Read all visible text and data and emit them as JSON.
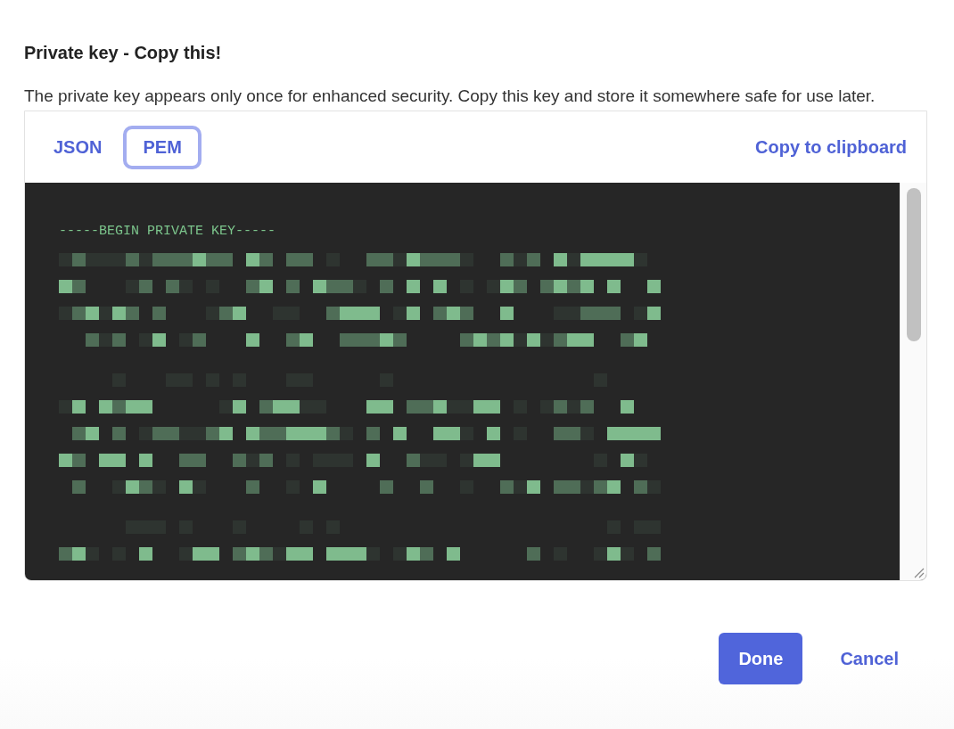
{
  "dialog": {
    "title": "Private key - Copy this!",
    "description": "The private key appears only once for enhanced security. Copy this key and store it somewhere safe for use later.",
    "tabs": [
      {
        "label": "JSON",
        "selected": false
      },
      {
        "label": "PEM",
        "selected": true
      }
    ],
    "copy_button": "Copy to clipboard",
    "key_header": "-----BEGIN PRIVATE KEY-----",
    "buttons": [
      {
        "label": "Done",
        "kind": "primary"
      },
      {
        "label": "Cancel",
        "kind": "secondary"
      }
    ]
  }
}
